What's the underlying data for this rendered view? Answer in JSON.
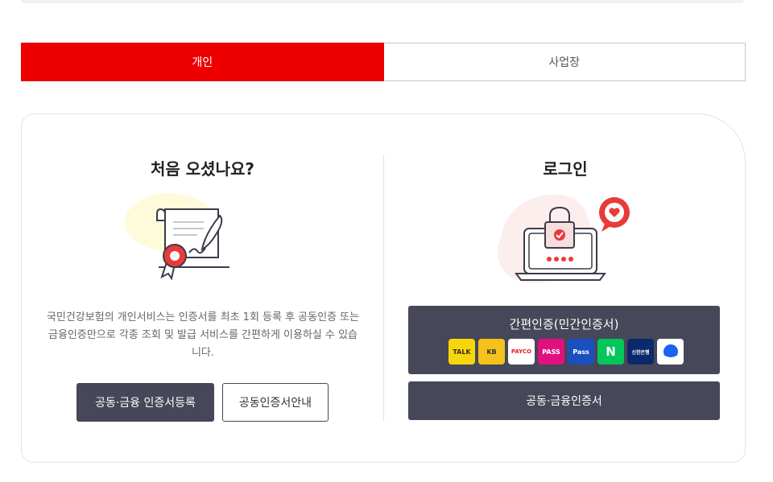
{
  "tabs": [
    {
      "label": "개인",
      "active": true
    },
    {
      "label": "사업장",
      "active": false
    }
  ],
  "left": {
    "title": "처음 오셨나요?",
    "description": "국민건강보험의 개인서비스는 인증서를 최초 1회 등록 후 공동인증 또는 금융인증만으로 각종 조회 및 발급 서비스를 간편하게 이용하실 수 있습니다.",
    "register_button": "공동·금융 인증서등록",
    "guide_button": "공동인증서안내"
  },
  "right": {
    "title": "로그인",
    "simple_auth_label": "간편인증(민간인증서)",
    "providers": [
      {
        "name": "kakao",
        "text": "TALK"
      },
      {
        "name": "kb",
        "text": "KB"
      },
      {
        "name": "payco",
        "text": "PAYCO"
      },
      {
        "name": "pass",
        "text": "PASS"
      },
      {
        "name": "samsung-pass",
        "text": "Pass"
      },
      {
        "name": "naver",
        "text": "N"
      },
      {
        "name": "shinhan",
        "text": "신한은행"
      },
      {
        "name": "toss",
        "text": ""
      }
    ],
    "joint_auth_button": "공동·금융인증서"
  },
  "colors": {
    "accent": "#ee0000",
    "button_dark": "#464758"
  }
}
